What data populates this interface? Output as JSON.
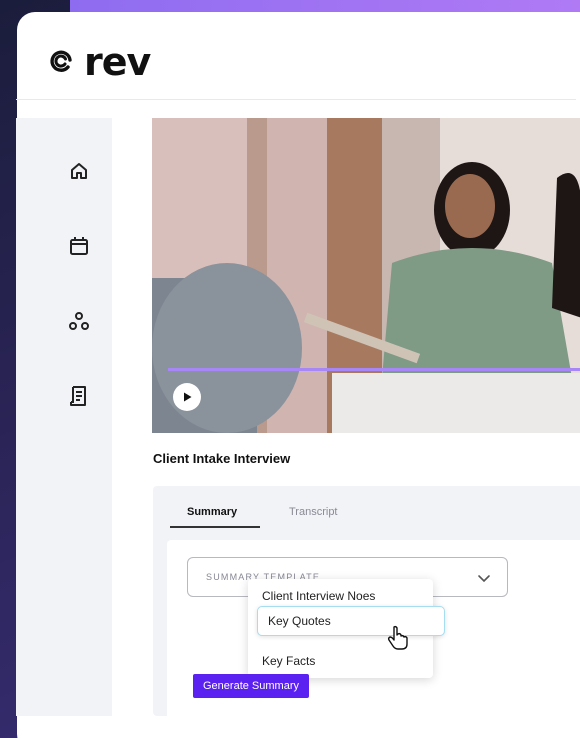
{
  "brand": {
    "name": "rev",
    "accent": "#5b21f0"
  },
  "nav": [
    {
      "icon": "home-icon"
    },
    {
      "icon": "calendar-icon"
    },
    {
      "icon": "team-icon"
    },
    {
      "icon": "document-icon"
    }
  ],
  "video": {
    "title": "Client Intake Interview",
    "progress": 1.0,
    "play_icon": "play-icon"
  },
  "tabs": {
    "summary": "Summary",
    "transcript": "Transcript",
    "active": "Summary"
  },
  "summary": {
    "template_label": "SUMMARY TEMPLATE",
    "options": [
      "Client Interview Noes",
      "Key Quotes",
      "Key Facts"
    ],
    "hovered_option": "Key Quotes",
    "generate_label": "Generate Summary"
  }
}
